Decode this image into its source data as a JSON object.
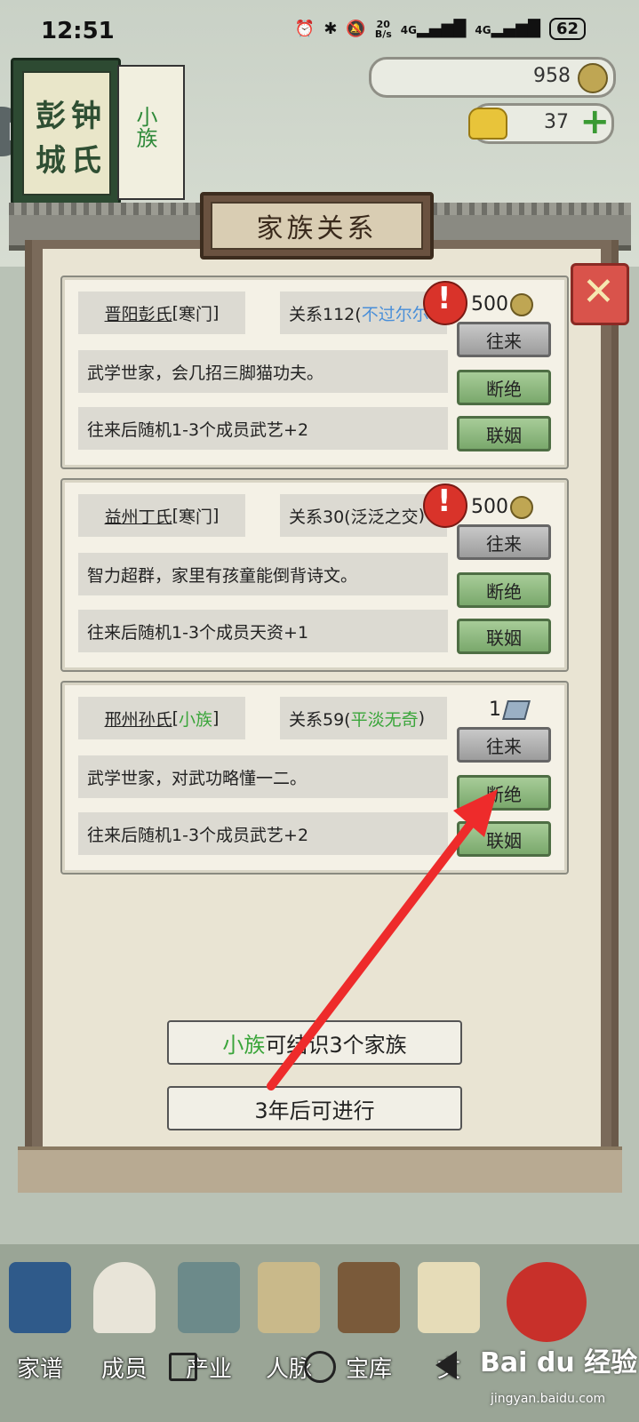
{
  "status_bar": {
    "time": "12:51",
    "net_speed_top": "20",
    "net_speed_bottom": "B/s",
    "signal1": "4G",
    "signal2": "4G",
    "battery": "62"
  },
  "family_book": {
    "surname_chars": [
      "彭",
      "城",
      "钟",
      "氏"
    ],
    "rank_tag": "小族"
  },
  "currency": {
    "coins": "958",
    "gold": "37"
  },
  "dialog": {
    "title": "家族关系",
    "cards": [
      {
        "name": "晋阳彭氏",
        "rank": "寒门",
        "rank_color": "#222222",
        "relation_prefix": "关系112(",
        "relation_desc": "不过尔尔",
        "relation_color": "#4a8fd8",
        "relation_suffix": "",
        "has_alert": true,
        "cost": "500",
        "cost_icon": "coin-icon",
        "description": "武学世家，会几招三脚猫功夫。",
        "bonus": "往来后随机1-3个成员武艺+2",
        "btn_visit": "往来",
        "btn_break": "断绝",
        "btn_marry": "联姻"
      },
      {
        "name": "益州丁氏",
        "rank": "寒门",
        "rank_color": "#222222",
        "relation_prefix": "关系30(",
        "relation_desc": "泛泛之交",
        "relation_color": "#222222",
        "relation_suffix": ")",
        "has_alert": true,
        "cost": "500",
        "cost_icon": "coin-icon",
        "description": "智力超群，家里有孩童能倒背诗文。",
        "bonus": "往来后随机1-3个成员天资+1",
        "btn_visit": "往来",
        "btn_break": "断绝",
        "btn_marry": "联姻"
      },
      {
        "name": "邢州孙氏",
        "rank": "小族",
        "rank_color": "#3aa53a",
        "relation_prefix": "关系59(",
        "relation_desc": "平淡无奇",
        "relation_color": "#3aa53a",
        "relation_suffix": ")",
        "has_alert": false,
        "cost": "1",
        "cost_icon": "paper-icon",
        "description": "武学世家，对武功略懂一二。",
        "bonus": "往来后随机1-3个成员武艺+2",
        "btn_visit": "往来",
        "btn_break": "断绝",
        "btn_marry": "联姻"
      }
    ],
    "info_rank": "小族",
    "info_text_1": "可结",
    "info_text_2": "识3个家族",
    "cooldown": "3年后可进行"
  },
  "bottom_nav": {
    "items": [
      "家谱",
      "成员",
      "产业",
      "人脉",
      "宝库",
      "文"
    ]
  },
  "watermark": {
    "main": "Bai du 经验",
    "sub": "jingyan.baidu.com"
  }
}
